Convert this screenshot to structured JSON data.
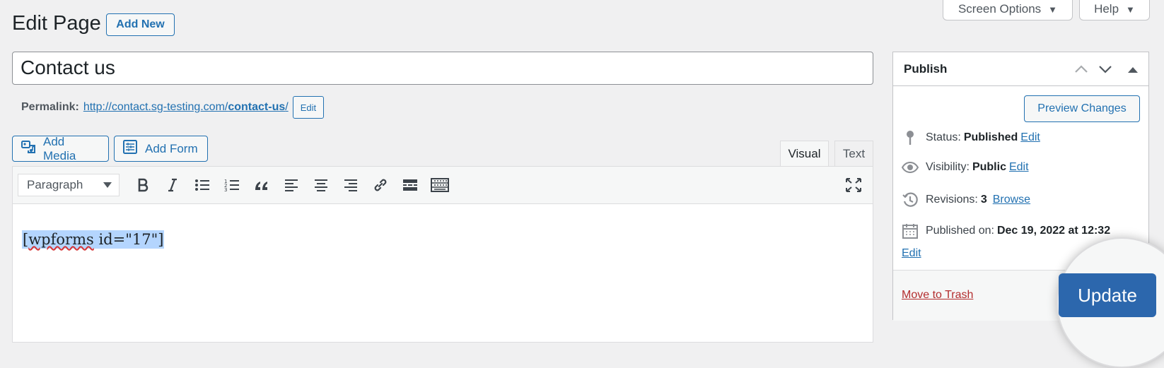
{
  "screen_options": {
    "label": "Screen Options",
    "caret": "▼"
  },
  "help": {
    "label": "Help",
    "caret": "▼"
  },
  "heading": {
    "title": "Edit Page",
    "add_new": "Add New"
  },
  "title_field": {
    "value": "Contact us"
  },
  "permalink": {
    "label": "Permalink:",
    "url_base": "http://contact.sg-testing.com/",
    "slug": "contact-us",
    "url_end": "/",
    "edit": "Edit"
  },
  "media_buttons": {
    "add_media": "Add Media",
    "add_form": "Add Form"
  },
  "editor_tabs": {
    "visual": "Visual",
    "text": "Text"
  },
  "toolbar": {
    "format_value": "Paragraph"
  },
  "content": {
    "shortcode_start": "[",
    "spell_word": "wpforms",
    "shortcode_rest": " id=\"17\"]"
  },
  "publish": {
    "title": "Publish",
    "preview_button": "Preview Changes",
    "status_label": "Status:",
    "status_value": "Published",
    "status_edit": "Edit",
    "visibility_label": "Visibility:",
    "visibility_value": "Public",
    "visibility_edit": "Edit",
    "revisions_label": "Revisions:",
    "revisions_value": "3",
    "revisions_browse": "Browse",
    "published_label": "Published on:",
    "published_value": "Dec 19, 2022 at 12:32",
    "published_edit": "Edit",
    "trash": "Move to Trash",
    "update": "Update"
  },
  "colors": {
    "accent": "#2271b1",
    "update_bg": "#2c67ad",
    "trash": "#b32d2e",
    "selection": "#b4d5fe"
  }
}
